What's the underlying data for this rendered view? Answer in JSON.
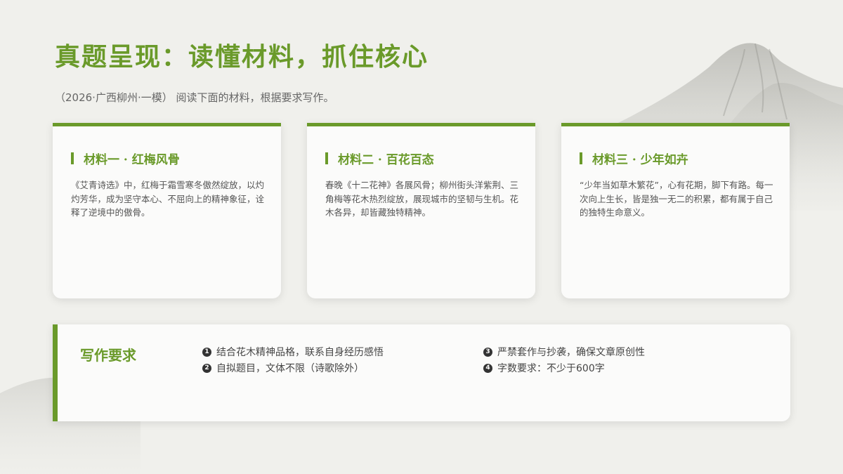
{
  "header": {
    "title": "真题呈现：读懂材料，抓住核心",
    "subtitle": "（2026·广西柳州·一模） 阅读下面的材料，根据要求写作。"
  },
  "materials": [
    {
      "title": "材料一 · 红梅风骨",
      "text": "《艾青诗选》中，红梅于霜雪寒冬傲然绽放，以灼灼芳华，成为坚守本心、不屈向上的精神象征，诠释了逆境中的傲骨。"
    },
    {
      "title": "材料二 · 百花百态",
      "text": "春晚《十二花神》各展风骨；柳州街头洋紫荆、三角梅等花木热烈绽放，展现城市的坚韧与生机。花木各异，却皆藏独特精神。"
    },
    {
      "title": "材料三 · 少年如卉",
      "text": "“少年当如草木繁花”，心有花期，脚下有路。每一次向上生长，皆是独一无二的积累，都有属于自己的独特生命意义。"
    }
  ],
  "requirements": {
    "title": "写作要求",
    "items": [
      {
        "num": "1",
        "text": "结合花木精神品格，联系自身经历感悟"
      },
      {
        "num": "2",
        "text": "自拟题目，文体不限（诗歌除外）"
      },
      {
        "num": "3",
        "text": "严禁套作与抄袭，确保文章原创性"
      },
      {
        "num": "4",
        "text": "字数要求：不少于600字"
      }
    ]
  },
  "colors": {
    "accent": "#6a9a2a",
    "background": "#f0f0ec",
    "card": "#fbfbfa"
  }
}
